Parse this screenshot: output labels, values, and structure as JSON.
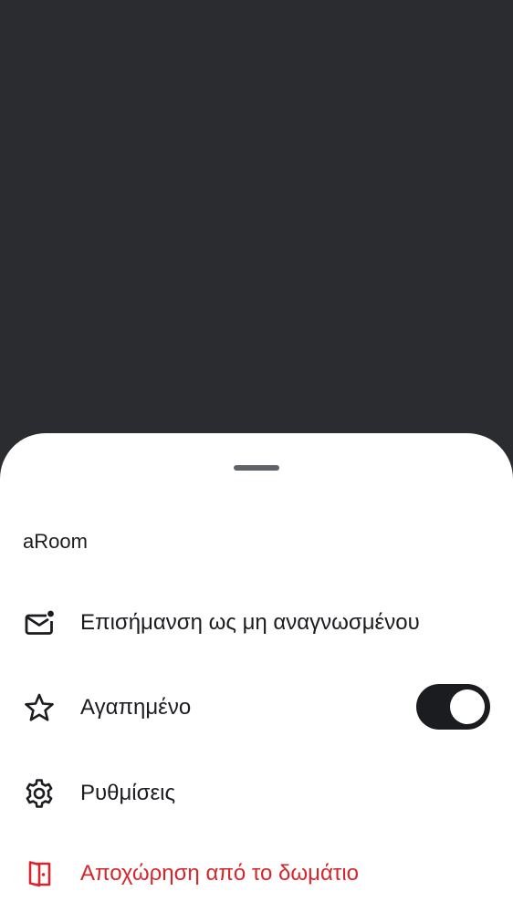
{
  "room": {
    "name": "aRoom"
  },
  "menu": {
    "items": [
      {
        "label": "Επισήμανση ως μη αναγνωσμένου",
        "icon": "mail-unread-icon"
      },
      {
        "label": "Αγαπημένο",
        "icon": "star-icon",
        "toggle_on": true
      },
      {
        "label": "Ρυθμίσεις",
        "icon": "gear-icon"
      },
      {
        "label": "Αποχώρηση από το δωμάτιο",
        "icon": "leave-door-icon",
        "color": "#d7262b"
      }
    ]
  },
  "colors": {
    "scrim": "#2b2c2f",
    "sheet": "#ffffff",
    "text": "#1b1c1f",
    "danger": "#d7262b",
    "toggle_track": "#1b1c1f"
  }
}
